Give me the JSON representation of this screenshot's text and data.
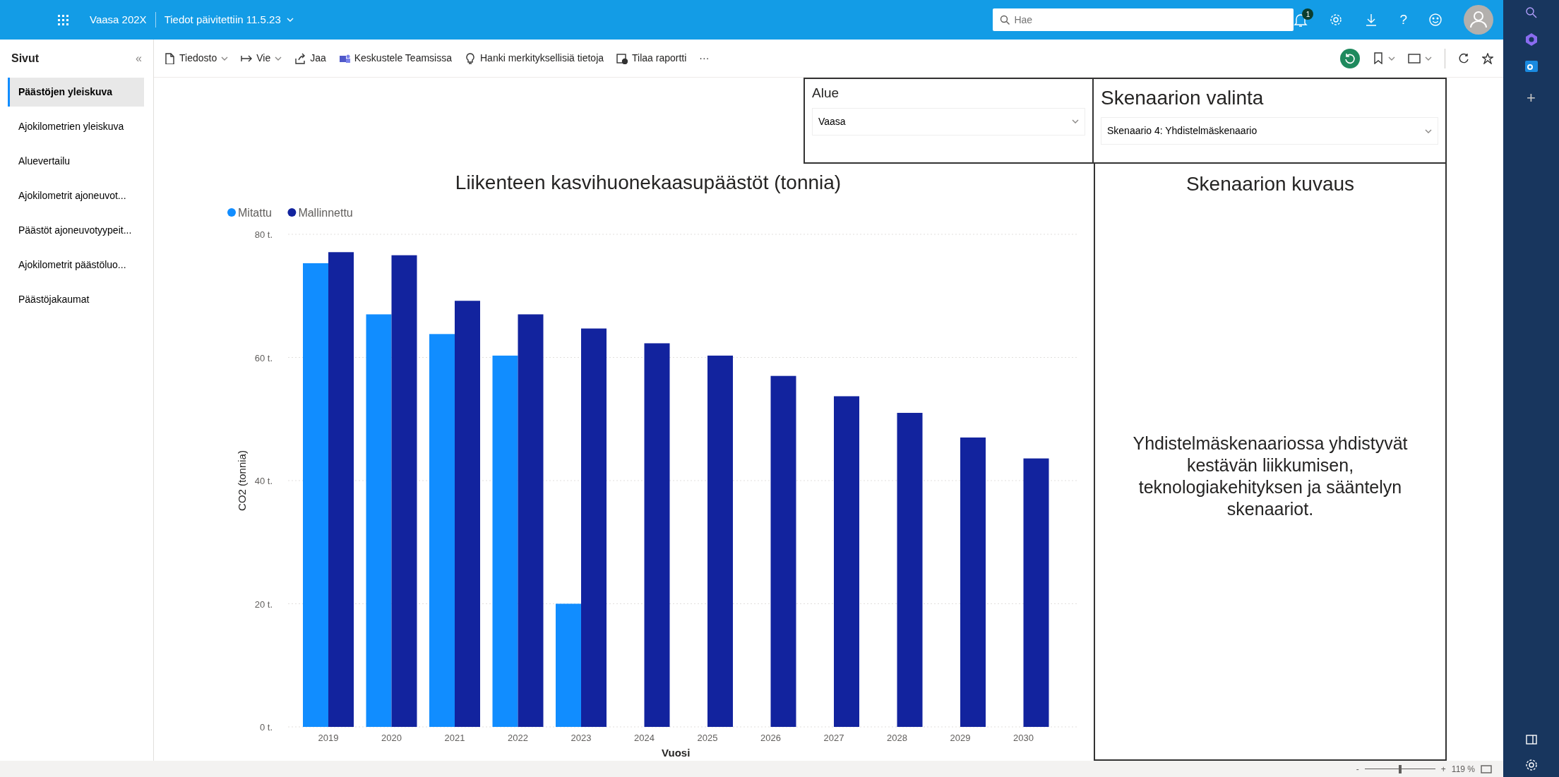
{
  "top_bar": {
    "app_name": "Vaasa 202X",
    "updated": "Tiedot päivitettiin 11.5.23",
    "search": {
      "placeholder": "Hae"
    },
    "notifications": "1",
    "help": "?"
  },
  "pages_panel": {
    "title": "Sivut",
    "collapse": "«",
    "items": [
      {
        "label": "Päästöjen yleiskuva",
        "selected": true
      },
      {
        "label": "Ajokilometrien yleiskuva",
        "selected": false
      },
      {
        "label": "Aluevertailu",
        "selected": false
      },
      {
        "label": "Ajokilometrit ajoneuvot...",
        "selected": false
      },
      {
        "label": "Päästöt ajoneuvotyypeit...",
        "selected": false
      },
      {
        "label": "Ajokilometrit päästöluo...",
        "selected": false
      },
      {
        "label": "Päästöjakaumat",
        "selected": false
      }
    ]
  },
  "toolbar": {
    "items": [
      {
        "label": "Tiedosto",
        "kind": "menu"
      },
      {
        "label": "Vie",
        "kind": "menu"
      },
      {
        "label": "Jaa",
        "kind": "plain"
      },
      {
        "label": "Keskustele Teamsissa",
        "kind": "plain"
      },
      {
        "label": "Hanki merkityksellisiä tietoja",
        "kind": "plain"
      },
      {
        "label": "Tilaa raportti",
        "kind": "plain"
      }
    ],
    "more": "···"
  },
  "slicers": [
    {
      "title": "Alue",
      "value": "Vaasa"
    },
    {
      "title": "Skenaarion valinta",
      "value": "Skenaario 4: Yhdistelmäskenaario"
    }
  ],
  "chart": {
    "chart_data": {
      "type": "bar",
      "title": "Liikenteen kasvihuonekaasupäästöt (tonnia)",
      "xlabel": "Vuosi",
      "ylabel": "CO2 (tonnia)",
      "categories": [
        "2019",
        "2020",
        "2021",
        "2022",
        "2023",
        "2024",
        "2025",
        "2026",
        "2027",
        "2028",
        "2029",
        "2030"
      ],
      "series": [
        {
          "name": "Mitattu",
          "color": "#118dff",
          "values": [
            75.3,
            67,
            63.8,
            60.3,
            20,
            null,
            null,
            null,
            null,
            null,
            null,
            null
          ]
        },
        {
          "name": "Mallinnettu",
          "color": "#12239e",
          "values": [
            77.1,
            76.6,
            69.2,
            67,
            64.7,
            62.3,
            60.3,
            57,
            53.7,
            51,
            47,
            43.6
          ]
        }
      ],
      "grid": true,
      "legend": true,
      "ylim": [
        0,
        80
      ],
      "yticks": [
        {
          "value": 0,
          "label": "0 t."
        },
        {
          "value": 20,
          "label": "20 t."
        },
        {
          "value": 40,
          "label": "40 t."
        },
        {
          "value": 60,
          "label": "60 t."
        },
        {
          "value": 80,
          "label": "80 t."
        }
      ]
    }
  },
  "description": {
    "title": "Skenaarion kuvaus",
    "text": "Yhdistelmäskenaariossa yhdistyvät kestävän liikkumisen, teknologiakehityksen ja sääntelyn skenaariot."
  },
  "right_rail": {
    "add": "+"
  },
  "status_bar": {
    "zoom": {
      "minus": "-",
      "plus": "+",
      "level": 0.5,
      "reading": "119 %"
    }
  }
}
